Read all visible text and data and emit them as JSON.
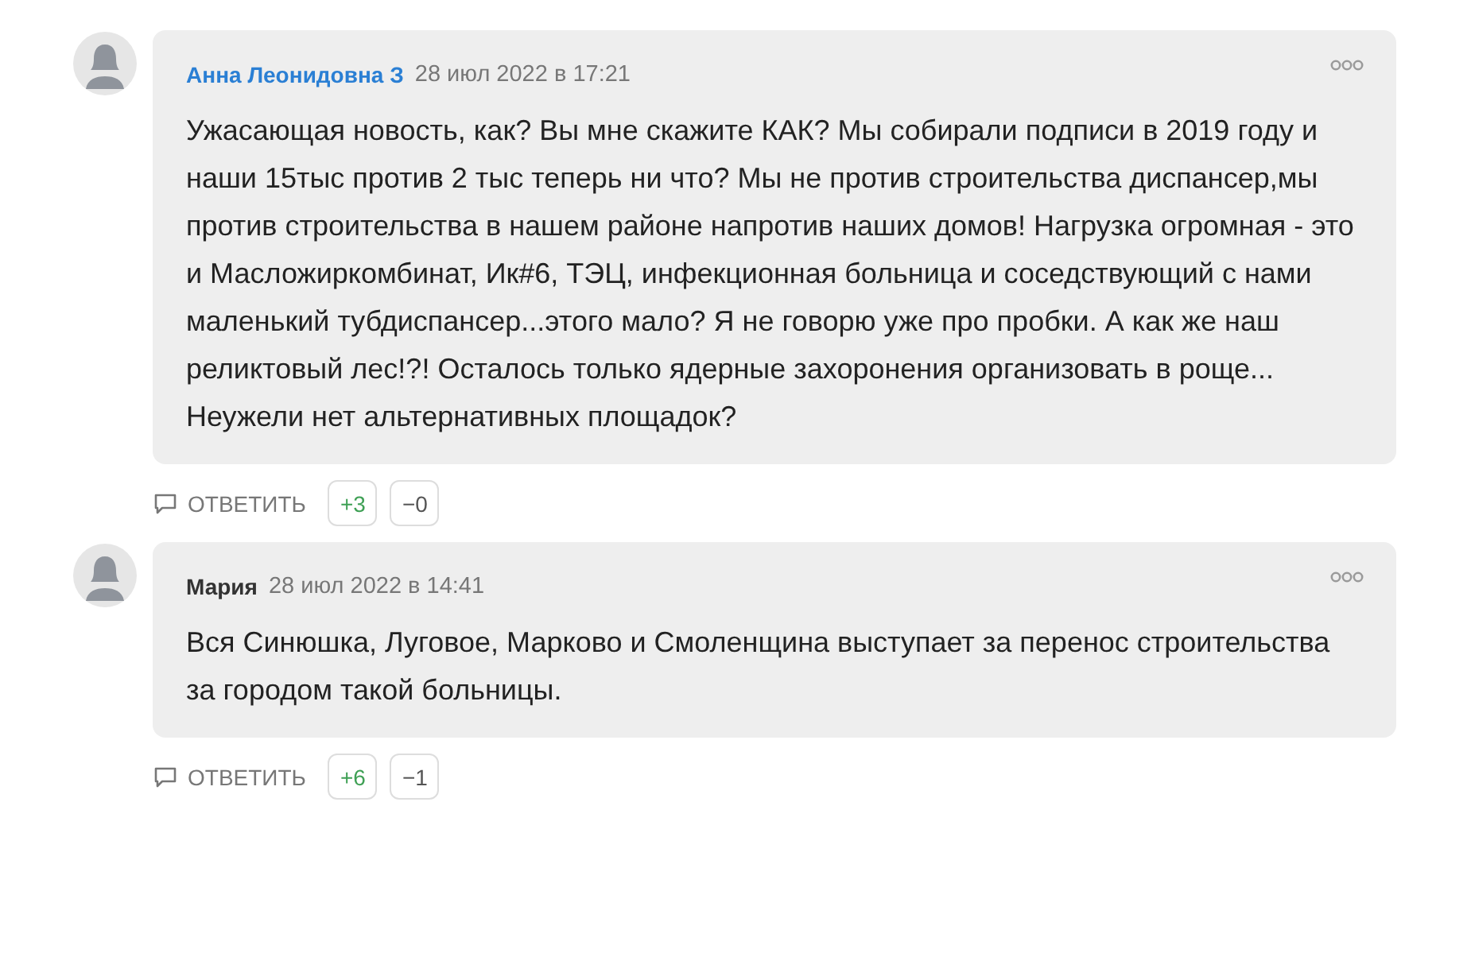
{
  "comments": [
    {
      "author": "Анна Леонидовна З",
      "color": "#2a7fd4",
      "date": "28 июл 2022 в 17:21",
      "paragraphs": [
        "Ужасающая новость, как? Вы мне скажите КАК? Мы собирали подписи в 2019 году и наши 15тыс против 2 тыс теперь ни что? Мы не против строительства диспансер,мы против строительства в нашем районе напротив наших домов! Нагрузка огромная - это и Масложиркомбинат, Ик#6, ТЭЦ, инфекционная больница и соседствующий с нами маленький тубдиспансер...этого мало? Я не говорю уже про пробки. А как же наш реликтовый лес!?! Осталось только ядерные захоронения организовать в роще...",
        "Неужели нет альтернативных площадок?"
      ],
      "reply": "ОТВЕТИТЬ",
      "plus": "+3",
      "minus": "−0"
    },
    {
      "author": "Мария",
      "color": "#333333",
      "date": "28 июл 2022 в 14:41",
      "paragraphs": [
        "Вся Синюшка, Луговое, Марково и Смоленщина выступает за перенос строительства за городом такой больницы."
      ],
      "reply": "ОТВЕТИТЬ",
      "plus": "+6",
      "minus": "−1"
    }
  ]
}
